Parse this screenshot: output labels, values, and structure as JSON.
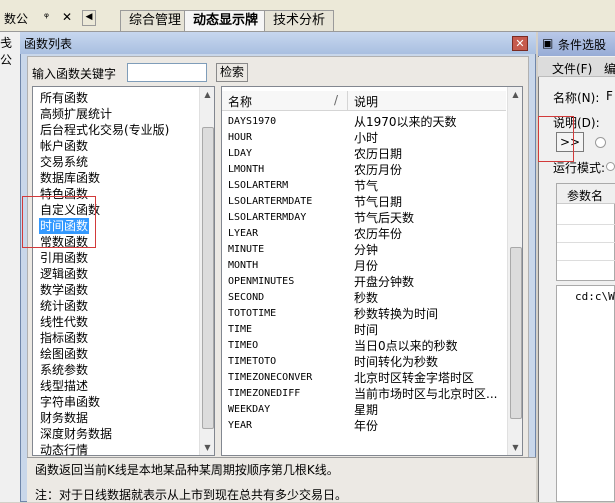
{
  "topbar": {
    "left_fragment": "数公",
    "pin_icon": "pin-icon",
    "close_icon": "close-icon",
    "tabs": [
      "综合管理",
      "动态显示牌",
      "技术分析"
    ],
    "active_tab": "动态显示牌",
    "side_text": "戋公"
  },
  "dialog": {
    "title": "函数列表",
    "search_label": "输入函数关键字",
    "search_value": "",
    "search_button": "检索",
    "categories": [
      "所有函数",
      "高频扩展统计",
      "后台程式化交易(专业版)",
      "帐户函数",
      "交易系统",
      "数据库函数",
      "特色函数",
      "自定义函数",
      "时间函数",
      "常数函数",
      "引用函数",
      "逻辑函数",
      "数学函数",
      "统计函数",
      "线性代数",
      "指标函数",
      "绘图函数",
      "系统参数",
      "线型描述",
      "字符串函数",
      "财务数据",
      "深度财务数据",
      "动态行情"
    ],
    "selected_category": "时间函数",
    "table": {
      "col_name": "名称",
      "col_slash": "/",
      "col_desc": "说明",
      "rows": [
        {
          "name": "DAYS1970",
          "desc": "从1970以来的天数"
        },
        {
          "name": "HOUR",
          "desc": "小时"
        },
        {
          "name": "LDAY",
          "desc": "农历日期"
        },
        {
          "name": "LMONTH",
          "desc": "农历月份"
        },
        {
          "name": "LSOLARTERM",
          "desc": "节气"
        },
        {
          "name": "LSOLARTERMDATE",
          "desc": "节气日期"
        },
        {
          "name": "LSOLARTERMDAY",
          "desc": "节气后天数"
        },
        {
          "name": "LYEAR",
          "desc": "农历年份"
        },
        {
          "name": "MINUTE",
          "desc": "分钟"
        },
        {
          "name": "MONTH",
          "desc": "月份"
        },
        {
          "name": "OPENMINUTES",
          "desc": "开盘分钟数"
        },
        {
          "name": "SECOND",
          "desc": "秒数"
        },
        {
          "name": "TOTOTIME",
          "desc": "秒数转换为时间"
        },
        {
          "name": "TIME",
          "desc": "时间"
        },
        {
          "name": "TIMEO",
          "desc": "当日0点以来的秒数"
        },
        {
          "name": "TIMETOTO",
          "desc": "时间转化为秒数"
        },
        {
          "name": "TIMEZONECONVER",
          "desc": "北京时区转金字塔时区"
        },
        {
          "name": "TIMEZONEDIFF",
          "desc": "当前市场时区与北京时区..."
        },
        {
          "name": "WEEKDAY",
          "desc": "星期"
        },
        {
          "name": "YEAR",
          "desc": "年份"
        }
      ]
    },
    "description": "函数返回当前K线是本地某品种某周期按顺序第几根K线。",
    "note": "注：对于日线数据就表示从上市到现在总共有多少交易日。"
  },
  "right_window": {
    "title": "条件选股",
    "menu_file": "文件(F)",
    "menu_edit": "编",
    "name_label": "名称(N):",
    "name_value": "F",
    "desc_label": "说明(D):",
    "btn_more": ">>",
    "run_mode_label": "运行模式:",
    "param_header": "参数名",
    "path_text": "cd:c\\W"
  },
  "colors": {
    "selection": "#3399ff",
    "highlight": "#d23a3a",
    "title_bar": "#a9bfe0"
  }
}
